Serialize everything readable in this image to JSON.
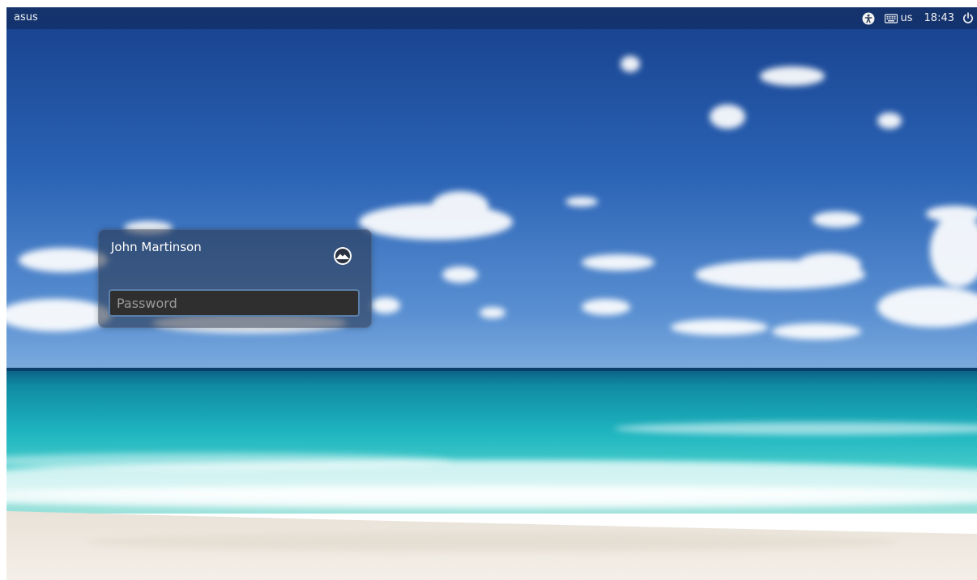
{
  "panel": {
    "hostname": "asus",
    "keyboard_layout": "us",
    "clock": "18:43",
    "icons": [
      "accessibility-icon",
      "keyboard-icon",
      "power-icon"
    ]
  },
  "greeter": {
    "user_name": "John Martinson",
    "session_icon": "ubuntu-session-icon",
    "password_placeholder": "Password",
    "password_value": ""
  },
  "wallpaper": {
    "description_colors": {
      "sky_top": "#1d4c9a",
      "sky_bottom": "#5a8fd0",
      "sea_deep": "#0f7f9a",
      "sea_turquoise": "#27c2c8",
      "sand": "#efe9df"
    }
  }
}
